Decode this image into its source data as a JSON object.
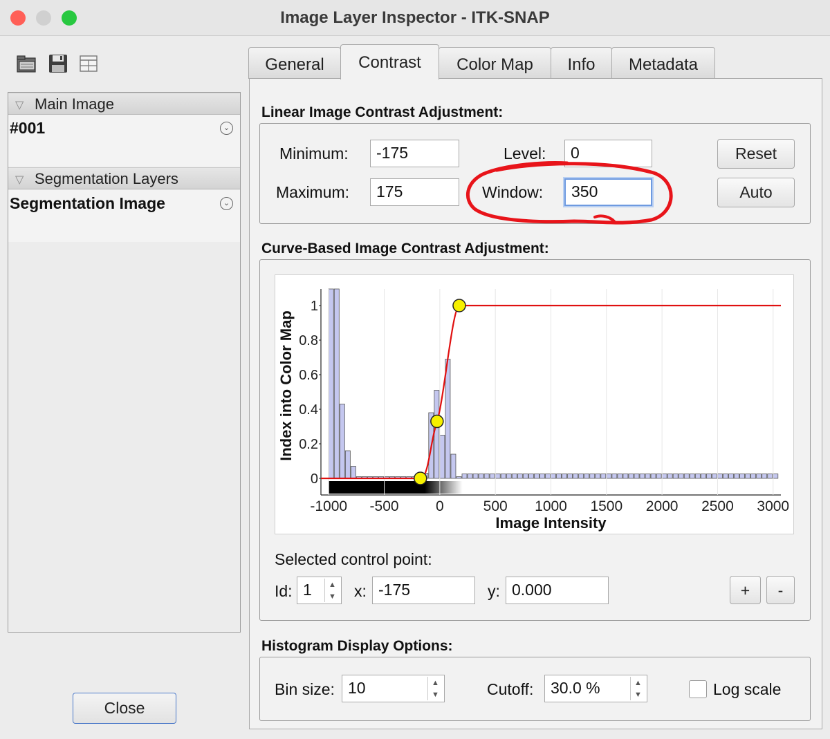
{
  "window": {
    "title": "Image Layer Inspector - ITK-SNAP",
    "traffic_colors": {
      "close": "#ff5f57",
      "minimize": "#d0d0d0",
      "zoom": "#28c840"
    }
  },
  "toolbar": {
    "icons": [
      "open-folder-icon",
      "save-disk-icon",
      "layout-grid-icon"
    ]
  },
  "layers": {
    "main_group_label": "Main Image",
    "main_item": "#001",
    "seg_group_label": "Segmentation Layers",
    "seg_item": "Segmentation Image"
  },
  "close_label": "Close",
  "tabs": [
    {
      "label": "General"
    },
    {
      "label": "Contrast"
    },
    {
      "label": "Color Map"
    },
    {
      "label": "Info"
    },
    {
      "label": "Metadata"
    }
  ],
  "linear": {
    "title": "Linear Image Contrast Adjustment:",
    "min_label": "Minimum:",
    "min_value": "-175",
    "max_label": "Maximum:",
    "max_value": "175",
    "level_label": "Level:",
    "level_value": "0",
    "window_label": "Window:",
    "window_value": "350",
    "reset_label": "Reset",
    "auto_label": "Auto",
    "annotation_color": "#e8141a"
  },
  "curve": {
    "title": "Curve-Based Image Contrast Adjustment:",
    "selected_label": "Selected control point:",
    "id_label": "Id:",
    "id_value": "1",
    "x_label": "x:",
    "x_value": "-175",
    "y_label": "y:",
    "y_value": "0.000",
    "plus_label": "+",
    "minus_label": "-"
  },
  "histogram": {
    "title": "Histogram Display Options:",
    "bin_label": "Bin size:",
    "bin_value": "10",
    "cutoff_label": "Cutoff:",
    "cutoff_value": "30.0 %",
    "log_label": "Log scale",
    "log_checked": false
  },
  "chart_data": {
    "type": "line",
    "xlabel": "Image Intensity",
    "ylabel": "Index into Color Map",
    "xlim": [
      -1070,
      3070
    ],
    "ylim": [
      0,
      1
    ],
    "x_ticks": [
      -1000,
      -500,
      0,
      500,
      1000,
      1500,
      2000,
      2500,
      3000
    ],
    "x_tick_labels": [
      "-1000",
      "-500",
      "0",
      "500",
      "1000",
      "1500",
      "2000",
      "2500",
      "3000"
    ],
    "y_ticks": [
      0,
      0.2,
      0.4,
      0.6,
      0.8,
      1
    ],
    "y_tick_labels": [
      "0",
      "0.2",
      "0.4",
      "0.6",
      "0.8",
      "1"
    ],
    "curve": {
      "color": "#e01010",
      "x": [
        -1070,
        -175,
        -25,
        175,
        3070
      ],
      "y": [
        0,
        0,
        0.33,
        1,
        1
      ]
    },
    "control_points": [
      {
        "x": -175,
        "y": 0
      },
      {
        "x": -25,
        "y": 0.33
      },
      {
        "x": 175,
        "y": 1
      }
    ],
    "control_point_color": "#f6f000",
    "histogram_bin_width": 50,
    "histogram_color": "#c4c7ef",
    "histogram": [
      {
        "x": -1000,
        "y": 1.1
      },
      {
        "x": -950,
        "y": 1.1
      },
      {
        "x": -900,
        "y": 0.43
      },
      {
        "x": -850,
        "y": 0.16
      },
      {
        "x": -800,
        "y": 0.07
      },
      {
        "x": -750,
        "y": 0.01
      },
      {
        "x": -700,
        "y": 0.01
      },
      {
        "x": -650,
        "y": 0.01
      },
      {
        "x": -600,
        "y": 0.01
      },
      {
        "x": -550,
        "y": 0.01
      },
      {
        "x": -500,
        "y": 0.01
      },
      {
        "x": -450,
        "y": 0.01
      },
      {
        "x": -400,
        "y": 0.01
      },
      {
        "x": -350,
        "y": 0.01
      },
      {
        "x": -300,
        "y": 0.01
      },
      {
        "x": -250,
        "y": 0.01
      },
      {
        "x": -200,
        "y": 0.01
      },
      {
        "x": -150,
        "y": 0.03
      },
      {
        "x": -100,
        "y": 0.38
      },
      {
        "x": -50,
        "y": 0.51
      },
      {
        "x": 0,
        "y": 0.25
      },
      {
        "x": 50,
        "y": 0.69
      },
      {
        "x": 100,
        "y": 0.14
      },
      {
        "x": 150,
        "y": 0.01
      }
    ],
    "histogram_tail": {
      "from": 200,
      "to": 3000,
      "y": 0.01
    }
  }
}
